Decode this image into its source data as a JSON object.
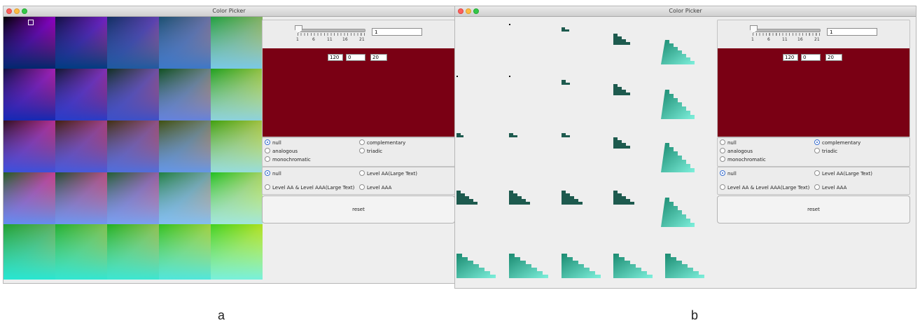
{
  "windows": [
    {
      "title": "Color Picker",
      "caption": "a",
      "slider": {
        "value": "1",
        "ticks": [
          "1",
          "6",
          "11",
          "16",
          "21"
        ]
      },
      "rgb": {
        "r": "120",
        "g": "0",
        "b": "20"
      },
      "swatch_color": "#7a0014",
      "harmony": {
        "options": [
          "null",
          "complementary",
          "analogous",
          "triadic",
          "monochromatic"
        ],
        "selected": "null"
      },
      "contrast": {
        "options": [
          "null",
          "Level AA(Large Text)",
          "Level AA & Level AAA(Large Text)",
          "Level AAA"
        ],
        "selected": "null"
      },
      "reset_label": "reset"
    },
    {
      "title": "Color Picker",
      "caption": "b",
      "slider": {
        "value": "1",
        "ticks": [
          "1",
          "6",
          "11",
          "16",
          "21"
        ]
      },
      "rgb": {
        "r": "120",
        "g": "0",
        "b": "20"
      },
      "swatch_color": "#7a0014",
      "harmony": {
        "options": [
          "null",
          "complementary",
          "analogous",
          "triadic",
          "monochromatic"
        ],
        "selected": "complementary"
      },
      "contrast": {
        "options": [
          "null",
          "Level AA(Large Text)",
          "Level AA & Level AAA(Large Text)",
          "Level AAA"
        ],
        "selected": "null"
      },
      "reset_label": "reset"
    }
  ],
  "colors": {
    "swatch": "#7a0014",
    "complement_dark": "#1d5a4e",
    "complement_light": "#3ee0c0"
  }
}
